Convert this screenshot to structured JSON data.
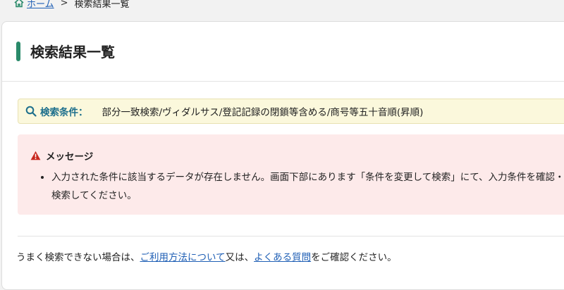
{
  "breadcrumb": {
    "home": "ホーム",
    "separator": ">",
    "current": "検索結果一覧"
  },
  "page": {
    "title": "検索結果一覧"
  },
  "search_condition": {
    "label": "検索条件：",
    "value": "部分一致検索/ヴィダルサス/登記記録の閉鎖等含める/商号等五十音順(昇順)"
  },
  "message": {
    "heading": "メッセージ",
    "items": [
      "入力された条件に該当するデータが存在しません。画面下部にあります「条件を変更して検索」にて、入力条件を確認・え、検索してください。"
    ]
  },
  "help": {
    "prefix": "うまく検索できない場合は、",
    "link1": "ご利用方法について",
    "middle": "又は、",
    "link2": "よくある質問",
    "suffix": "をご確認ください。"
  },
  "colors": {
    "accent": "#2a8a6a",
    "link": "#1f5fb5",
    "condition_bg": "#fbf8dc",
    "message_bg": "#fdeaea",
    "warning": "#c8281e"
  }
}
